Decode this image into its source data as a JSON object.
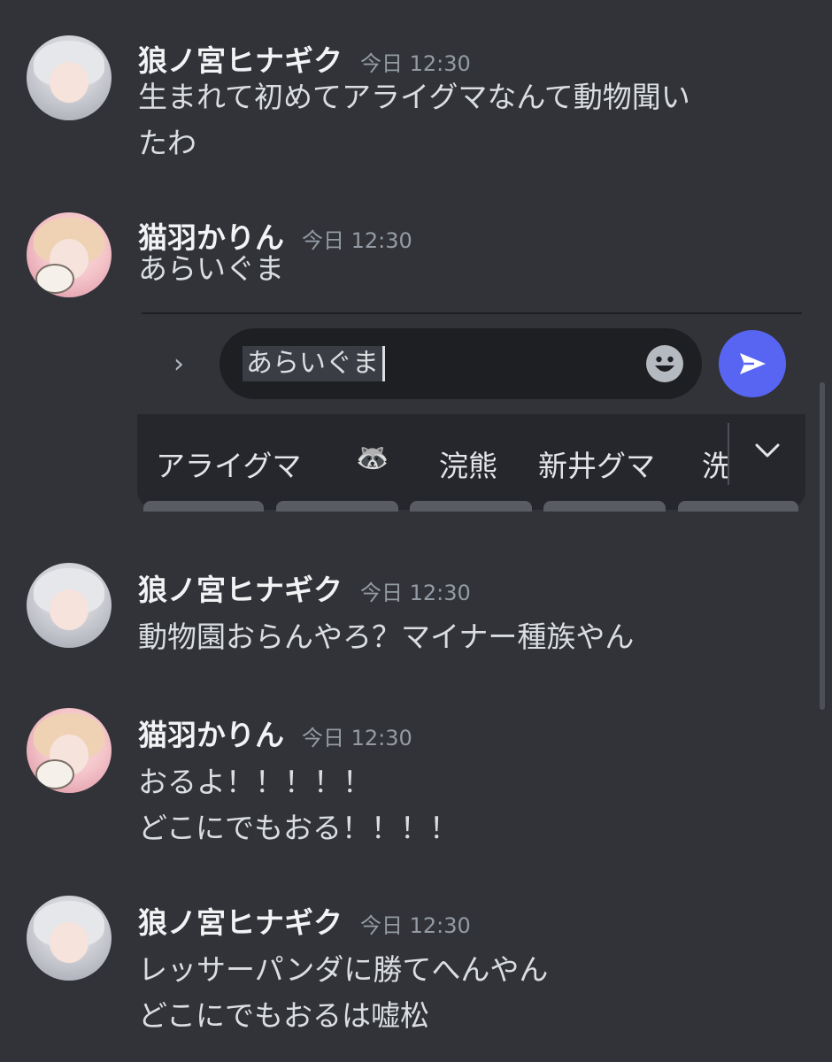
{
  "messages": [
    {
      "author": "狼ノ宮ヒナギク",
      "time": "今日 12:30",
      "lines": [
        "生まれて初めてアライグマなんて動物聞い",
        "たわ"
      ]
    },
    {
      "author": "猫羽かりん",
      "time": "今日 12:30",
      "lines": [
        "あらいぐま"
      ]
    },
    {
      "author": "狼ノ宮ヒナギク",
      "time": "今日 12:30",
      "lines": [
        "動物園おらんやろ？マイナー種族やん"
      ]
    },
    {
      "author": "猫羽かりん",
      "time": "今日 12:30",
      "lines": [
        "おるよ！！！！！",
        "どこにでもおる！！！！"
      ]
    },
    {
      "author": "狼ノ宮ヒナギク",
      "time": "今日 12:30",
      "lines": [
        "レッサーパンダに勝てへんやん",
        "どこにでもおるは嘘松"
      ]
    }
  ],
  "composer": {
    "expand_glyph": "›",
    "input_value": "あらいぐま",
    "emoji_icon": "smiley-face-icon",
    "send_icon": "paper-plane-icon",
    "accent": "#5865f2"
  },
  "keyboard": {
    "candidates": [
      "アライグマ",
      "🦝",
      "浣熊",
      "新井グマ",
      "洗"
    ],
    "expand_glyph": "⌄"
  }
}
